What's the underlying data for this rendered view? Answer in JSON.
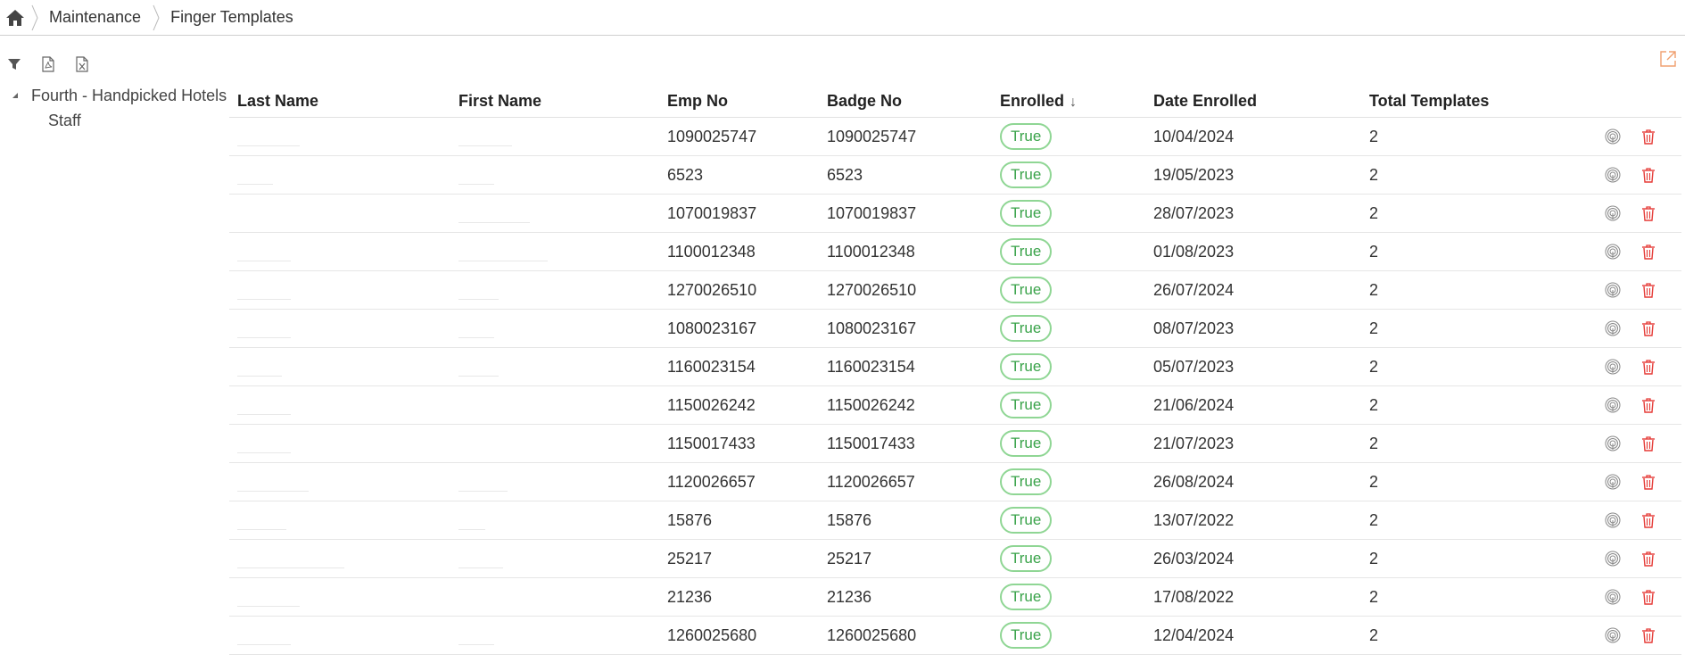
{
  "breadcrumb": {
    "items": [
      {
        "label": "Maintenance"
      },
      {
        "label": "Finger Templates"
      }
    ]
  },
  "tree": {
    "root": "Fourth - Handpicked Hotels",
    "child": "Staff"
  },
  "grid": {
    "columns": {
      "last_name": "Last Name",
      "first_name": "First Name",
      "emp_no": "Emp No",
      "badge_no": "Badge No",
      "enrolled": "Enrolled",
      "date_enrolled": "Date Enrolled",
      "total_templates": "Total Templates",
      "sort_arrow": "↓"
    },
    "rows": [
      {
        "emp_no": "1090025747",
        "badge_no": "1090025747",
        "enrolled": "True",
        "date": "10/04/2024",
        "total": "2"
      },
      {
        "emp_no": "6523",
        "badge_no": "6523",
        "enrolled": "True",
        "date": "19/05/2023",
        "total": "2"
      },
      {
        "emp_no": "1070019837",
        "badge_no": "1070019837",
        "enrolled": "True",
        "date": "28/07/2023",
        "total": "2"
      },
      {
        "emp_no": "1100012348",
        "badge_no": "1100012348",
        "enrolled": "True",
        "date": "01/08/2023",
        "total": "2"
      },
      {
        "emp_no": "1270026510",
        "badge_no": "1270026510",
        "enrolled": "True",
        "date": "26/07/2024",
        "total": "2"
      },
      {
        "emp_no": "1080023167",
        "badge_no": "1080023167",
        "enrolled": "True",
        "date": "08/07/2023",
        "total": "2"
      },
      {
        "emp_no": "1160023154",
        "badge_no": "1160023154",
        "enrolled": "True",
        "date": "05/07/2023",
        "total": "2"
      },
      {
        "emp_no": "1150026242",
        "badge_no": "1150026242",
        "enrolled": "True",
        "date": "21/06/2024",
        "total": "2"
      },
      {
        "emp_no": "1150017433",
        "badge_no": "1150017433",
        "enrolled": "True",
        "date": "21/07/2023",
        "total": "2"
      },
      {
        "emp_no": "1120026657",
        "badge_no": "1120026657",
        "enrolled": "True",
        "date": "26/08/2024",
        "total": "2"
      },
      {
        "emp_no": "15876",
        "badge_no": "15876",
        "enrolled": "True",
        "date": "13/07/2022",
        "total": "2"
      },
      {
        "emp_no": "25217",
        "badge_no": "25217",
        "enrolled": "True",
        "date": "26/03/2024",
        "total": "2"
      },
      {
        "emp_no": "21236",
        "badge_no": "21236",
        "enrolled": "True",
        "date": "17/08/2022",
        "total": "2"
      },
      {
        "emp_no": "1260025680",
        "badge_no": "1260025680",
        "enrolled": "True",
        "date": "12/04/2024",
        "total": "2"
      }
    ]
  },
  "icons": {
    "home": "home-icon",
    "filter": "filter-icon",
    "pdf": "pdf-export-icon",
    "excel": "excel-export-icon",
    "popout": "popout-icon",
    "fingerprint": "fingerprint-icon",
    "delete": "trash-icon"
  },
  "colors": {
    "enrolled_border": "#8fd694",
    "enrolled_text": "#3aa34a",
    "delete": "#e53935",
    "popout": "#f0a070"
  }
}
